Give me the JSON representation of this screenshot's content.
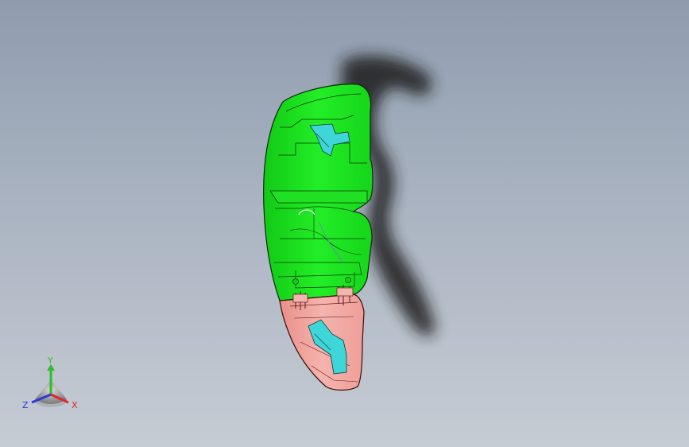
{
  "viewport": {
    "background_top": "#8f9cae",
    "background_bottom": "#c6ccd4"
  },
  "model": {
    "upper_body_color": "#19e31c",
    "lower_body_color": "#f2a6a0",
    "insert_color": "#3fd6d8",
    "shadow_color": "#1a1a1a",
    "edge_color": "#0b2a0b"
  },
  "triad": {
    "x_label": "X",
    "y_label": "Y",
    "z_label": "Z",
    "x_color": "#e0262d",
    "y_color": "#2bbd2b",
    "z_color": "#2a3bd6"
  }
}
